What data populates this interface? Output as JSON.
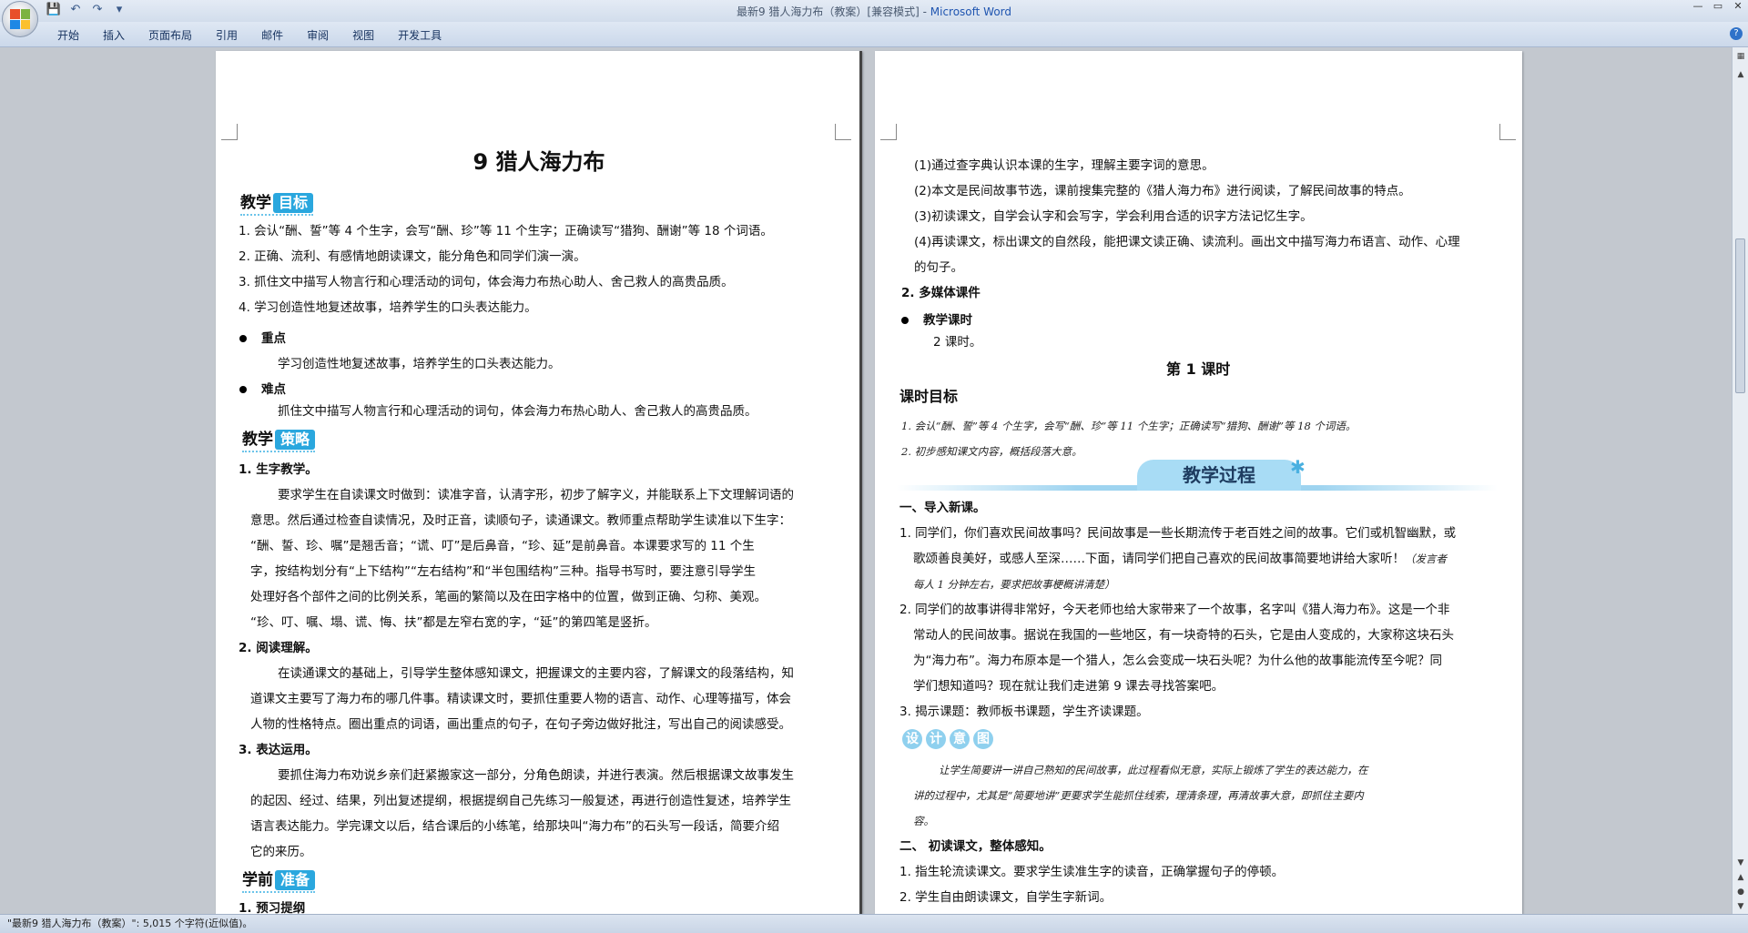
{
  "window": {
    "title": "最新9 猎人海力布（教案）[兼容模式] - ",
    "app_name": "Microsoft Word"
  },
  "ribbon": {
    "tabs": [
      "开始",
      "插入",
      "页面布局",
      "引用",
      "邮件",
      "审阅",
      "视图",
      "开发工具"
    ]
  },
  "status_bar": {
    "text": "\"最新9 猎人海力布（教案）\": 5,015 个字符(近似值)。"
  },
  "page_left": {
    "title": "9  猎人海力布",
    "sec_objectives": {
      "prefix": "教学",
      "badge": "目标"
    },
    "objectives": [
      "1. 会认“酬、誓”等 4 个生字，会写“酬、珍”等 11 个生字；正确读写“猎狗、酬谢”等 18 个词语。",
      "2. 正确、流利、有感情地朗读课文，能分角色和同学们演一演。",
      "3. 抓住文中描写人物言行和心理活动的词句，体会海力布热心助人、舍己救人的高贵品质。",
      "4. 学习创造性地复述故事，培养学生的口头表达能力。"
    ],
    "key_label": "重点",
    "key_text": "学习创造性地复述故事，培养学生的口头表达能力。",
    "diff_label": "难点",
    "diff_text": "抓住文中描写人物言行和心理活动的词句，体会海力布热心助人、舍己救人的高贵品质。",
    "sec_strategy": {
      "prefix": "教学",
      "badge": "策略"
    },
    "s1_title": "1. 生字教学。",
    "s1_lines": [
      "要求学生在自读课文时做到：读准字音，认清字形，初步了解字义，并能联系上下文理解词语的",
      "意思。然后通过检查自读情况，及时正音，读顺句子，读通课文。教师重点帮助学生读准以下生字：",
      "“酬、誓、珍、嘱”是翘舌音；“谎、叮”是后鼻音，“珍、延”是前鼻音。本课要求写的 11 个生",
      "字，按结构划分有“上下结构”“左右结构”和“半包围结构”三种。指导书写时，要注意引导学生",
      "处理好各个部件之间的比例关系，笔画的繁简以及在田字格中的位置，做到正确、匀称、美观。",
      "“珍、叮、嘱、塌、谎、悔、扶”都是左窄右宽的字，“延”的第四笔是竖折。"
    ],
    "s2_title": "2. 阅读理解。",
    "s2_lines": [
      "在读通课文的基础上，引导学生整体感知课文，把握课文的主要内容，了解课文的段落结构，知",
      "道课文主要写了海力布的哪几件事。精读课文时，要抓住重要人物的语言、动作、心理等描写，体会",
      "人物的性格特点。圈出重点的词语，画出重点的句子，在句子旁边做好批注，写出自己的阅读感受。"
    ],
    "s3_title": "3. 表达运用。",
    "s3_lines": [
      "要抓住海力布劝说乡亲们赶紧搬家这一部分，分角色朗读，并进行表演。然后根据课文故事发生",
      "的起因、经过、结果，列出复述提纲，根据提纲自己先练习一般复述，再进行创造性复述，培养学生",
      "语言表达能力。学完课文以后，结合课后的小练笔，给那块叫“海力布”的石头写一段话，简要介绍",
      "它的来历。"
    ],
    "sec_prep": {
      "prefix": "学前",
      "badge": "准备"
    },
    "prep_title": "1. 预习提纲"
  },
  "page_right": {
    "prep_items": [
      "(1)通过查字典认识本课的生字，理解主要字词的意思。",
      "(2)本文是民间故事节选，课前搜集完整的《猎人海力布》进行阅读，了解民间故事的特点。",
      "(3)初读课文，自学会认字和会写字，学会利用合适的识字方法记忆生字。",
      "(4)再读课文，标出课文的自然段，能把课文读正确、读流利。画出文中描写海力布语言、动作、心理",
      "的句子。"
    ],
    "media": "2. 多媒体课件",
    "hours_label": "教学课时",
    "hours_text": "2 课时。",
    "lesson_title": "第 1 课时",
    "lesson_goal": "课时目标",
    "goals": [
      "1. 会认“酬、誓”等 4 个生字，会写“酬、珍”等 11 个生字；正确读写“猎狗、酬谢”等 18 个词语。",
      "2. 初步感知课文内容，概括段落大意。"
    ],
    "process_label": "教学过程",
    "part1": "一、导入新课。",
    "p1_lines": [
      "1. 同学们，你们喜欢民间故事吗？民间故事是一些长期流传于老百姓之间的故事。它们或机智幽默，或",
      "歌颂善良美好，或感人至深……下面，请同学们把自己喜欢的民间故事简要地讲给大家听！",
      "（发言者",
      "每人 1 分钟左右，要求把故事梗概讲清楚）"
    ],
    "p2_lines": [
      "2. 同学们的故事讲得非常好，今天老师也给大家带来了一个故事，名字叫《猎人海力布》。这是一个非",
      "常动人的民间故事。据说在我国的一些地区，有一块奇特的石头，它是由人变成的，大家称这块石头",
      "为“海力布”。海力布原本是一个猎人，怎么会变成一块石头呢？为什么他的故事能流传至今呢？同",
      "学们想知道吗？现在就让我们走进第 9 课去寻找答案吧。"
    ],
    "p3": "3. 揭示课题：教师板书课题，学生齐读课题。",
    "design_chars": [
      "设",
      "计",
      "意",
      "图"
    ],
    "design_lines": [
      "让学生简要讲一讲自己熟知的民间故事，此过程看似无意，实际上锻炼了学生的表达能力，在",
      "讲的过程中，尤其是“简要地讲”更要求学生能抓住线索，理清条理，再清故事大意，即抓住主要内",
      "容。"
    ],
    "part2": "二、 初读课文，整体感知。",
    "q1": "1. 指生轮流读课文。要求学生读准生字的读音，正确掌握句子的停顿。",
    "q2": "2. 学生自由朗读课文，自学生字新词。"
  },
  "colors": {
    "accent": "#2aa7de",
    "title_blue": "#1f55b0"
  }
}
